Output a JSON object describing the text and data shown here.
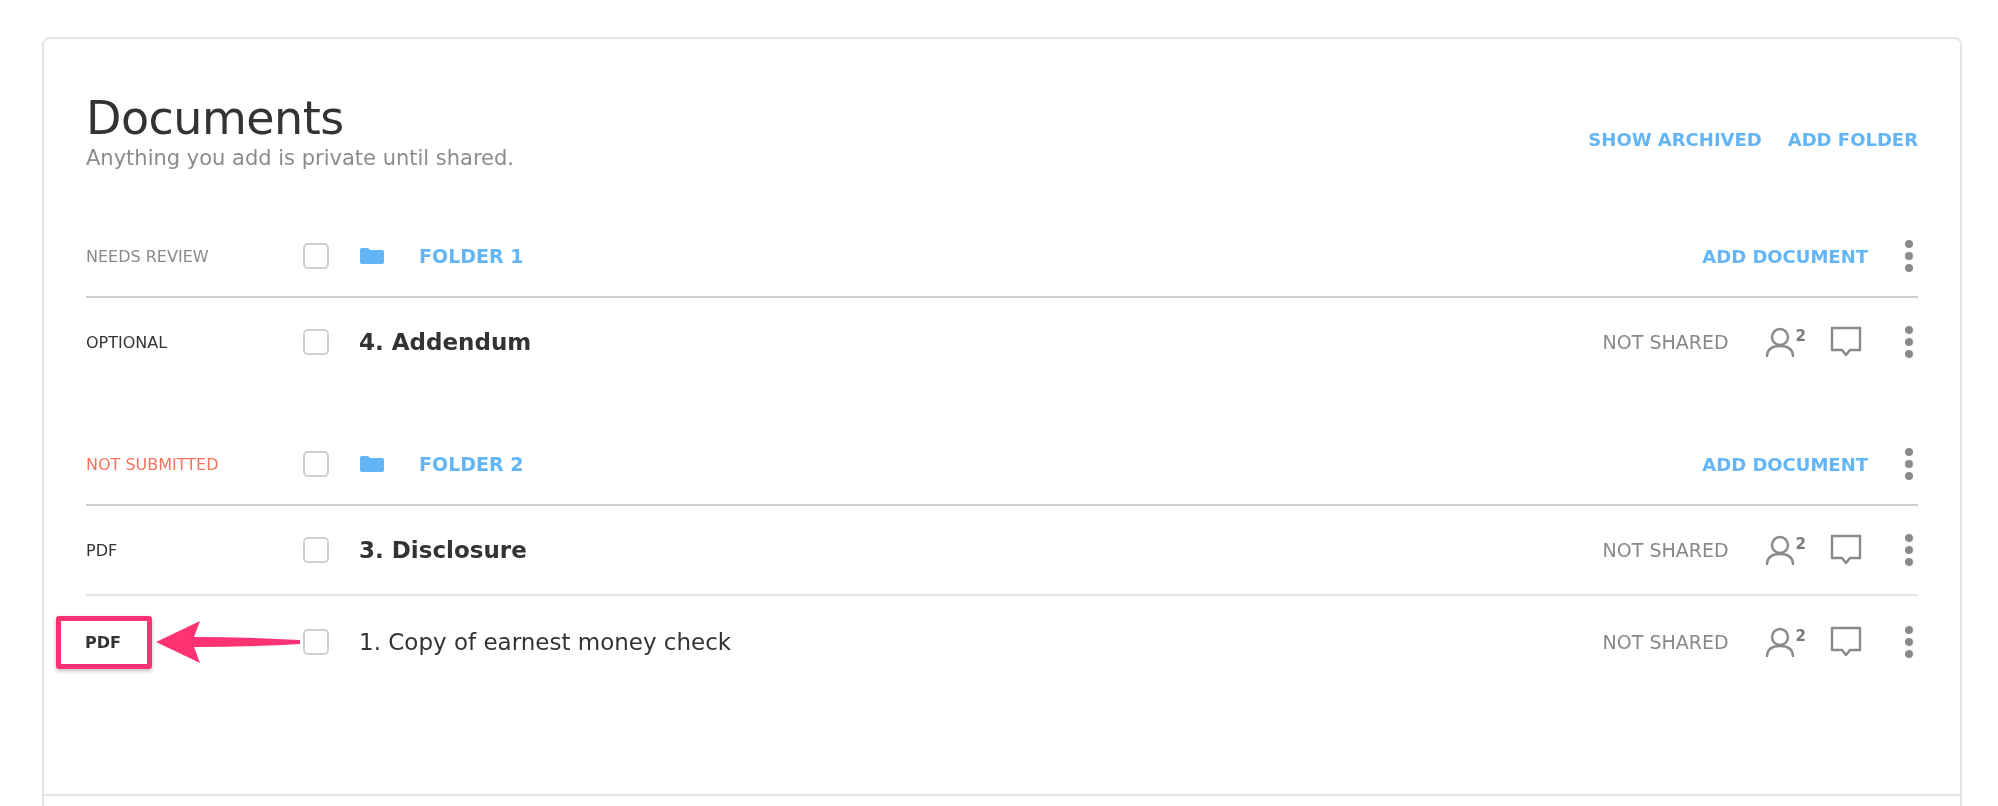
{
  "header": {
    "title": "Documents",
    "subtitle": "Anything you add is private until shared.",
    "actions": [
      "SHOW ARCHIVED",
      "ADD FOLDER"
    ]
  },
  "sections": [
    {
      "folder": {
        "status": "NEEDS REVIEW",
        "color": "#8a8a8a",
        "checked": false,
        "name": "FOLDER 1",
        "action": "ADD DOCUMENT"
      },
      "documents": [
        {
          "type": "OPTIONAL",
          "checked": false,
          "name": "4. Addendum",
          "bold": true,
          "highlighted": false,
          "sharing": "NOT SHARED",
          "shared_count": "2"
        }
      ]
    },
    {
      "folder": {
        "status": "NOT SUBMITTED",
        "color": "#f4745f",
        "checked": false,
        "name": "FOLDER 2",
        "action": "ADD DOCUMENT"
      },
      "documents": [
        {
          "type": "PDF",
          "checked": false,
          "name": "3. Disclosure",
          "bold": true,
          "highlighted": false,
          "sharing": "NOT SHARED",
          "shared_count": "2"
        },
        {
          "type": "PDF",
          "checked": false,
          "name": "1. Copy of earnest money check",
          "bold": false,
          "highlighted": true,
          "sharing": "NOT SHARED",
          "shared_count": "2"
        }
      ]
    }
  ]
}
